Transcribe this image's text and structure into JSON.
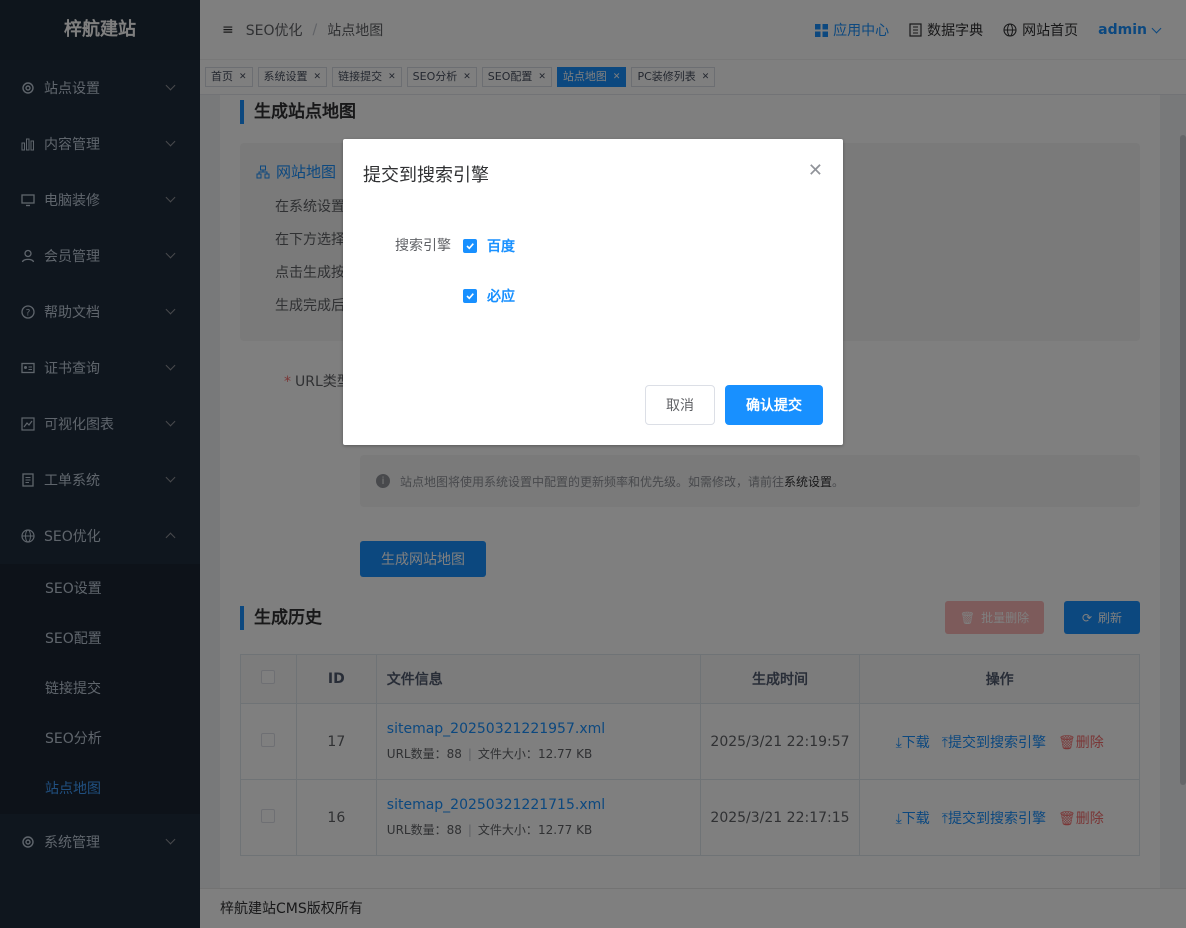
{
  "sidebar": {
    "logo": "梓航建站",
    "menu": [
      {
        "label": "站点设置",
        "icon": "gear-icon"
      },
      {
        "label": "内容管理",
        "icon": "bar-chart-icon"
      },
      {
        "label": "电脑装修",
        "icon": "monitor-icon"
      },
      {
        "label": "会员管理",
        "icon": "user-icon"
      },
      {
        "label": "帮助文档",
        "icon": "question-icon"
      },
      {
        "label": "证书查询",
        "icon": "id-card-icon"
      },
      {
        "label": "可视化图表",
        "icon": "line-chart-icon"
      },
      {
        "label": "工单系统",
        "icon": "document-icon"
      },
      {
        "label": "SEO优化",
        "icon": "globe-icon"
      }
    ],
    "seo_sub": [
      "SEO设置",
      "SEO配置",
      "链接提交",
      "SEO分析",
      "站点地图"
    ],
    "system": {
      "label": "系统管理",
      "icon": "gear-icon"
    }
  },
  "header": {
    "breadcrumb": [
      "SEO优化",
      "站点地图"
    ],
    "app_center": "应用中心",
    "dictionary": "数据字典",
    "home": "网站首页",
    "user": "admin"
  },
  "tags": [
    "首页",
    "系统设置",
    "链接提交",
    "SEO分析",
    "SEO配置",
    "站点地图",
    "PC装修列表"
  ],
  "page": {
    "gen_title": "生成站点地图",
    "info_head": "网站地图",
    "info_lines": [
      "在系统设置",
      "在下方选择",
      "点击生成按",
      "生成完成后"
    ],
    "url_label": "URL类型",
    "hint_prefix": "站点地图将使用系统设置中配置的更新频率和优先级。如需修改，请前往",
    "hint_link": "系统设置",
    "hint_suffix": "。",
    "gen_button": "生成网站地图",
    "history_title": "生成历史",
    "batch_delete": "批量删除",
    "refresh": "刷新"
  },
  "table": {
    "headers": [
      "ID",
      "文件信息",
      "生成时间",
      "操作"
    ],
    "url_count_label": "URL数量：",
    "file_size_label": "文件大小：",
    "rows": [
      {
        "id": "17",
        "file": "sitemap_20250321221957.xml",
        "urls": "88",
        "size": "12.77 KB",
        "time": "2025/3/21 22:19:57"
      },
      {
        "id": "16",
        "file": "sitemap_20250321221715.xml",
        "urls": "88",
        "size": "12.77 KB",
        "time": "2025/3/21 22:17:15"
      }
    ],
    "actions": {
      "download": "下载",
      "submit": "提交到搜索引擎",
      "delete": "删除"
    }
  },
  "footer": "梓航建站CMS版权所有",
  "dialog": {
    "title": "提交到搜索引擎",
    "label": "搜索引擎",
    "options": [
      {
        "label": "百度",
        "checked": true
      },
      {
        "label": "必应",
        "checked": true
      }
    ],
    "cancel": "取消",
    "confirm": "确认提交"
  },
  "colors": {
    "primary": "#1890ff",
    "sidebar": "#1f2d3d",
    "danger": "#f56c6c"
  }
}
